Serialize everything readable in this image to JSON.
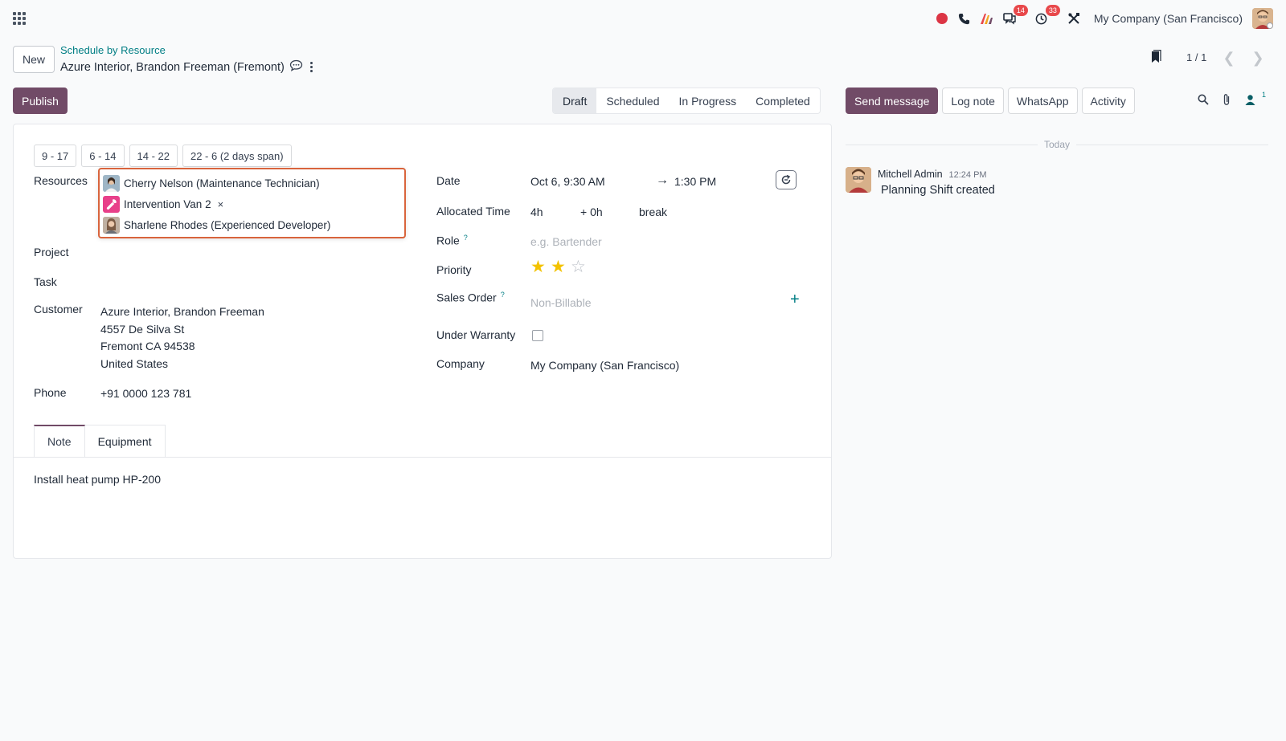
{
  "systray": {
    "discuss_badge": "14",
    "activity_badge": "33",
    "company": "My Company (San Francisco)"
  },
  "control": {
    "new_label": "New",
    "breadcrumb_parent": "Schedule by Resource",
    "record_title": "Azure Interior, Brandon Freeman (Fremont)",
    "pager_value": "1 / 1"
  },
  "actions": {
    "publish_label": "Publish"
  },
  "statusbar": {
    "items": [
      "Draft",
      "Scheduled",
      "In Progress",
      "Completed"
    ],
    "active": "Draft"
  },
  "chatter": {
    "send_message": "Send message",
    "log_note": "Log note",
    "whatsapp": "WhatsApp",
    "activity": "Activity",
    "follower_count": "1",
    "today_label": "Today",
    "message": {
      "author": "Mitchell Admin",
      "time": "12:24 PM",
      "body": "Planning Shift created"
    }
  },
  "form": {
    "templates": [
      "9 - 17",
      "6 - 14",
      "14 - 22",
      "22 - 6 (2 days span)"
    ],
    "resources_label": "Resources",
    "resources": [
      {
        "name": "Cherry Nelson (Maintenance Technician)",
        "avatar": "person-avatar"
      },
      {
        "name": "Intervention Van 2",
        "avatar": "wrench-icon",
        "remove": "×"
      },
      {
        "name": "Sharlene Rhodes (Experienced Developer)",
        "avatar": "person-avatar"
      }
    ],
    "project_label": "Project",
    "task_label": "Task",
    "customer_label": "Customer",
    "customer_lines": [
      "Azure Interior, Brandon Freeman",
      "4557 De Silva St",
      "Fremont CA 94538",
      "United States"
    ],
    "phone_label": "Phone",
    "phone_value": "+91 0000 123 781",
    "date_label": "Date",
    "date_start": "Oct 6, 9:30 AM",
    "date_end": "1:30 PM",
    "allocated_label": "Allocated Time",
    "allocated_hours": "4h",
    "allocated_extra": "+ 0h",
    "allocated_break": "break",
    "role_label": "Role",
    "role_help": "?",
    "role_placeholder": "e.g. Bartender",
    "priority_label": "Priority",
    "priority_value": 2,
    "priority_max": 3,
    "sales_order_label": "Sales Order",
    "sales_order_help": "?",
    "sales_order_placeholder": "Non-Billable",
    "warranty_label": "Under Warranty",
    "warranty_checked": false,
    "company_label": "Company",
    "company_value": "My Company (San Francisco)"
  },
  "tabs": {
    "items": [
      "Note",
      "Equipment"
    ],
    "active": "Note",
    "note_text": "Install heat pump HP-200"
  },
  "colors": {
    "brand": "#714b67",
    "link": "#017e84",
    "highlight_border": "#d9643c",
    "star": "#f3c200",
    "badge": "#e8484b"
  }
}
